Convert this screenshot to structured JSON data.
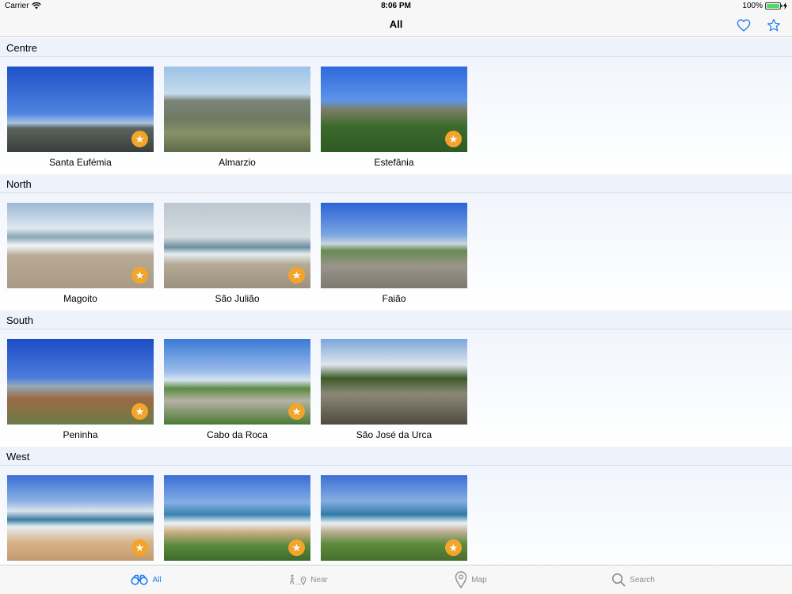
{
  "status_bar": {
    "carrier": "Carrier",
    "time": "8:06 PM",
    "battery": "100%"
  },
  "nav": {
    "title": "All",
    "heart_icon": "heart-icon",
    "star_icon": "star-icon"
  },
  "colors": {
    "accent": "#1e7cf2",
    "favorite_badge": "#f3a52b",
    "section_bg": "#eef3fb"
  },
  "sections": [
    {
      "title": "Centre",
      "items": [
        {
          "name": "Santa Eufémia",
          "favorite": true
        },
        {
          "name": "Almarzio",
          "favorite": false
        },
        {
          "name": "Estefânia",
          "favorite": true
        }
      ]
    },
    {
      "title": "North",
      "items": [
        {
          "name": "Magoito",
          "favorite": true
        },
        {
          "name": "São Julião",
          "favorite": true
        },
        {
          "name": "Faião",
          "favorite": false
        }
      ]
    },
    {
      "title": "South",
      "items": [
        {
          "name": "Peninha",
          "favorite": true
        },
        {
          "name": "Cabo da Roca",
          "favorite": true
        },
        {
          "name": "São José da Urca",
          "favorite": false
        }
      ]
    },
    {
      "title": "West",
      "items": [
        {
          "name": "",
          "favorite": true
        },
        {
          "name": "",
          "favorite": true
        },
        {
          "name": "",
          "favorite": true
        }
      ]
    }
  ],
  "tabs": [
    {
      "label": "All",
      "icon": "binoculars-icon",
      "active": true
    },
    {
      "label": "Near",
      "icon": "walking-pin-icon",
      "active": false
    },
    {
      "label": "Map",
      "icon": "map-pin-icon",
      "active": false
    },
    {
      "label": "Search",
      "icon": "search-icon",
      "active": false
    }
  ]
}
